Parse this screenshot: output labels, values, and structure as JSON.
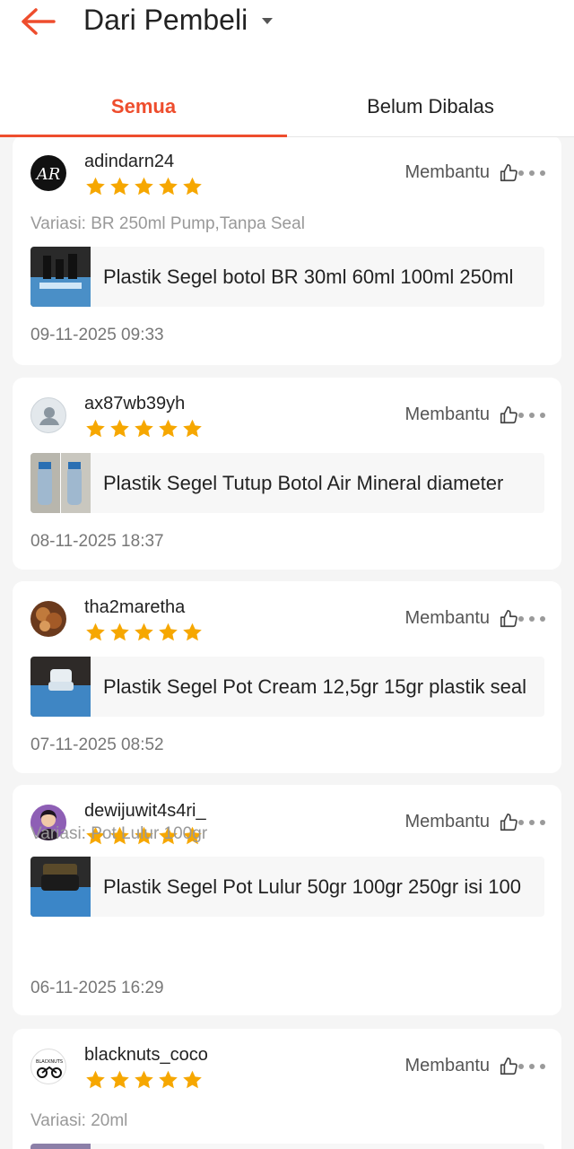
{
  "header": {
    "title": "Dari Pembeli"
  },
  "tabs": [
    {
      "label": "Semua"
    },
    {
      "label": "Belum Dibalas"
    }
  ],
  "colors": {
    "accent": "#ee4d2d",
    "star": "#f6a700"
  },
  "reviews": [
    {
      "username": "adindarn24",
      "rating": 5,
      "helpful_label": "Membantu",
      "variation": "Variasi: BR 250ml Pump,Tanpa Seal",
      "product": "Plastik Segel botol BR 30ml 60ml 100ml 250ml",
      "date": "09-11-2025 09:33",
      "avatar": "logo-avatar"
    },
    {
      "username": "ax87wb39yh",
      "rating": 5,
      "helpful_label": "Membantu",
      "variation": "",
      "product": "Plastik Segel Tutup Botol Air Mineral diameter",
      "date": "08-11-2025 18:37",
      "avatar": "default-user-avatar"
    },
    {
      "username": "tha2maretha",
      "rating": 5,
      "helpful_label": "Membantu",
      "variation": "",
      "product": "Plastik Segel Pot Cream 12,5gr 15gr plastik seal",
      "date": "07-11-2025 08:52",
      "avatar": "photo-avatar"
    },
    {
      "username": "dewijuwit4s4ri_",
      "rating": 5,
      "helpful_label": "Membantu",
      "variation": "Variasi: Pot Lulur 100gr",
      "product": "Plastik Segel Pot Lulur 50gr 100gr 250gr isi 100",
      "date": "06-11-2025 16:29",
      "avatar": "photo-avatar"
    },
    {
      "username": "blacknuts_coco",
      "rating": 5,
      "helpful_label": "Membantu",
      "variation": "Variasi: 20ml",
      "product": "",
      "date": "",
      "avatar": "logo-avatar"
    }
  ]
}
